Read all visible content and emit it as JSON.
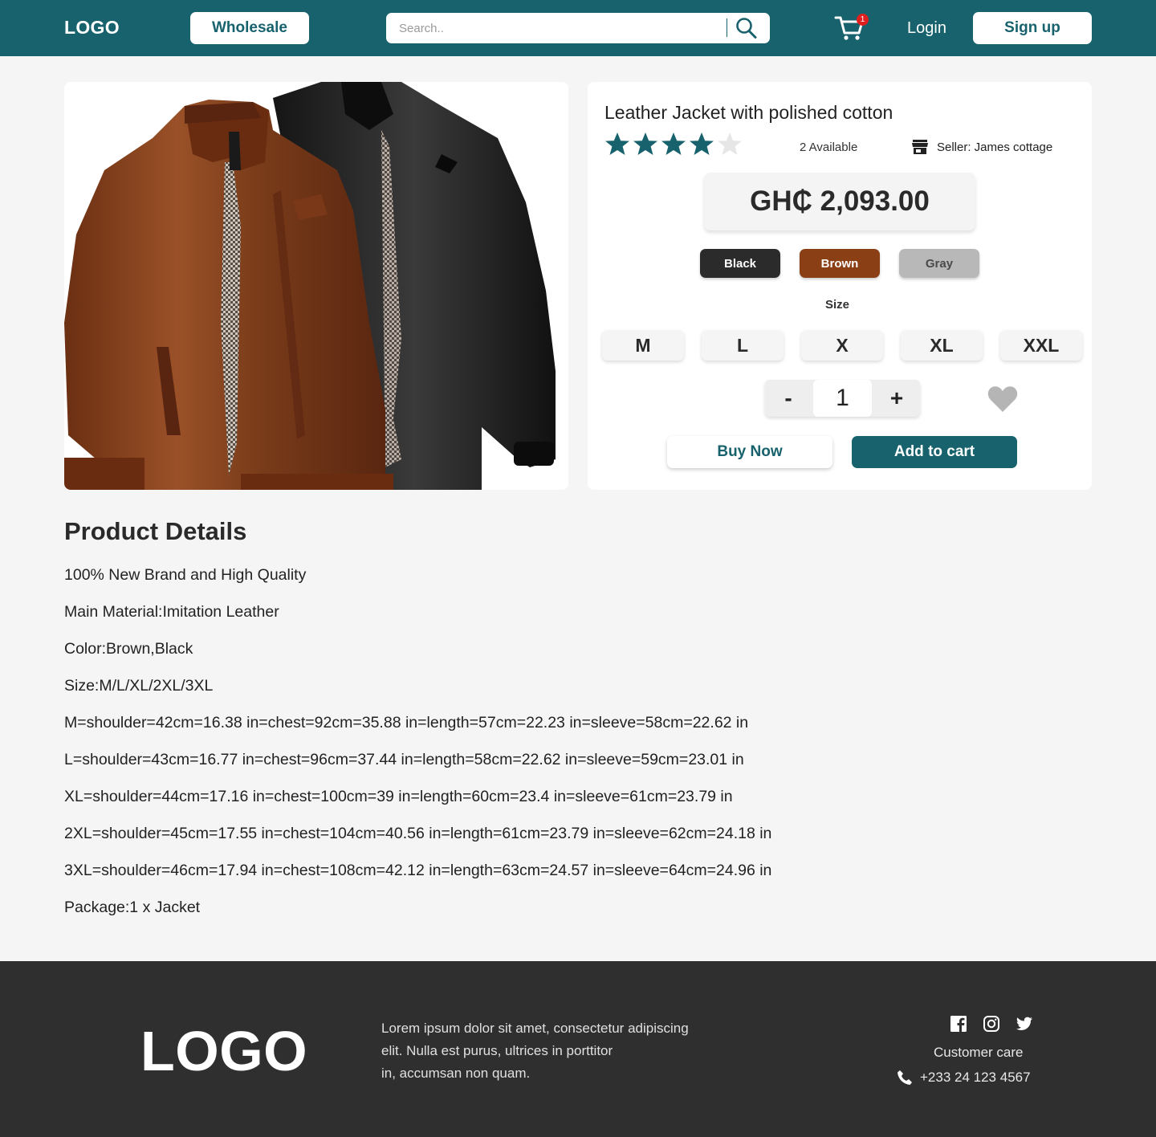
{
  "header": {
    "logo": "LOGO",
    "wholesale_label": "Wholesale",
    "search_placeholder": "Search..",
    "cart_count": "1",
    "login_label": "Login",
    "signup_label": "Sign up"
  },
  "colors": {
    "primary": "#17626d",
    "footer": "#2f2f2f",
    "black_swatch": "#2b2b2b",
    "brown_swatch": "#8b3f14",
    "gray_swatch": "#b8b8b8",
    "star_filled": "#17626d",
    "star_empty": "#e6e6e6",
    "badge": "#e0201f"
  },
  "product": {
    "title": "Leather Jacket with polished cotton",
    "rating": 4,
    "rating_max": 5,
    "available": "2 Available",
    "seller": "Seller: James cottage",
    "price": "GH₵ 2,093.00",
    "color_options": [
      "Black",
      "Brown",
      "Gray"
    ],
    "size_label": "Size",
    "sizes": [
      "M",
      "L",
      "X",
      "XL",
      "XXL"
    ],
    "quantity": "1",
    "minus_label": "-",
    "plus_label": "+",
    "buy_label": "Buy Now",
    "cart_label": "Add to cart"
  },
  "details": {
    "title": "Product Details",
    "lines": [
      "100% New Brand and High Quality",
      "Main Material:Imitation Leather",
      "Color:Brown,Black",
      "Size:M/L/XL/2XL/3XL",
      "M=shoulder=42cm=16.38 in=chest=92cm=35.88 in=length=57cm=22.23 in=sleeve=58cm=22.62 in",
      "L=shoulder=43cm=16.77 in=chest=96cm=37.44 in=length=58cm=22.62 in=sleeve=59cm=23.01 in",
      "XL=shoulder=44cm=17.16 in=chest=100cm=39 in=length=60cm=23.4 in=sleeve=61cm=23.79 in",
      "2XL=shoulder=45cm=17.55 in=chest=104cm=40.56 in=length=61cm=23.79 in=sleeve=62cm=24.18 in",
      "3XL=shoulder=46cm=17.94 in=chest=108cm=42.12 in=length=63cm=24.57 in=sleeve=64cm=24.96 in",
      "Package:1 x Jacket"
    ]
  },
  "footer": {
    "logo": "LOGO",
    "text_lines": [
      "Lorem ipsum dolor sit amet, consectetur adipiscing",
      "elit. Nulla est purus, ultrices in porttitor",
      "in, accumsan non quam."
    ],
    "social": [
      "facebook-icon",
      "instagram-icon",
      "twitter-icon"
    ],
    "care_label": "Customer care",
    "phone": "+233 24 123 4567"
  }
}
